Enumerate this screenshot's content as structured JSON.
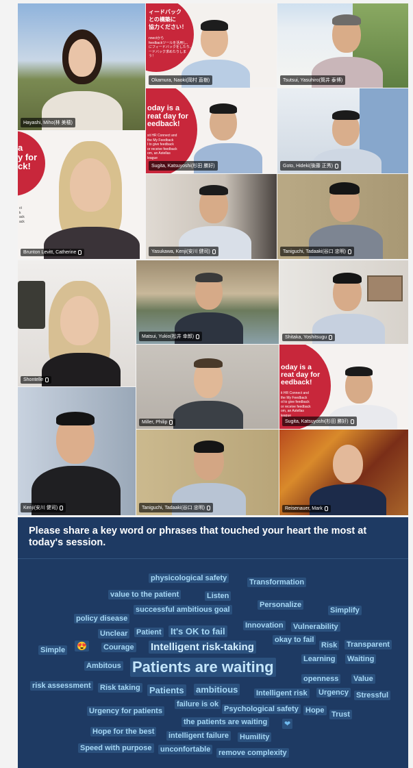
{
  "panel1": {
    "tiles": [
      {
        "name": "Hayashi, Miho(林 美穂)"
      },
      {
        "name": "Okamura, Naoki(岡村 直樹)"
      },
      {
        "name": "Tsutsui, Yasuhiro(筒井 泰博)"
      },
      {
        "name": "Brunton Levitt, Catherine"
      },
      {
        "name": "Sugita, Katsuyoshi(杉田 勝好)"
      },
      {
        "name": "Goto, Hideki(後藤 正秀)"
      },
      {
        "name": "Yasukawa, Kenji(安川 健司)"
      },
      {
        "name": "Taniguchi, Tadaaki(谷口 忠明)"
      }
    ],
    "poster_top": {
      "line1": "ィードバック",
      "line2": "との構築に",
      "line3": "協力ください！",
      "small": "nnectから\nfeedbackツールを活用し、\nにフィードバックをしたり、\nードバック求めたりしま\nう！"
    },
    "poster_mid": {
      "title": "oday is a\nreat day for\needback!",
      "small": "sit HR Connect and\nthe My Feedback\nl to give feedback\nor receive feedback\nom, an Astellas\nleague"
    },
    "poster_left": {
      "title": "a\ny for\nck!",
      "small": "ct\nk\nack\nack"
    }
  },
  "panel2": {
    "tiles": [
      {
        "name": "Shontelle"
      },
      {
        "name": "Matsui, Yukio(松井 幸郎)"
      },
      {
        "name": "Shitaka, Yoshitsugu"
      },
      {
        "name": "Miller, Philip"
      },
      {
        "name": "Sugita, Katsuyoshi(杉田 勝好)"
      },
      {
        "name": "Kenji(安川 健司)"
      },
      {
        "name": "Taniguchi, Tadaaki(谷口 忠明)"
      },
      {
        "name": "Reisenauer, Mark"
      }
    ],
    "poster": {
      "title": "oday is a\nreat day for\needback!",
      "small": "it HR Connect and\nthe My Feedback\nol to give feedback\nor receive feedback\nom, an Astellas\nleague"
    }
  },
  "cloud": {
    "prompt": "Please share a key word or phrases that touched your heart the most at today's session.",
    "emoji": "😍",
    "heart": "❤",
    "words": [
      "physicological safety",
      "Transformation",
      "value to the patient",
      "Listen",
      "Personalize",
      "successful ambitious goal",
      "Simplify",
      "policy disease",
      "Innovation",
      "Vulnerability",
      "Unclear",
      "Patient",
      "It's OK to fail",
      "okay to fail",
      "Simple",
      "Courage",
      "Intelligent risk-taking",
      "Risk",
      "Transparent",
      "Learning",
      "Waiting",
      "Ambitous",
      "Patients are waiting",
      "openness",
      "Value",
      "risk assessment",
      "Risk taking",
      "Patients",
      "ambitious",
      "Intelligent risk",
      "Urgency",
      "Stressful",
      "failure is ok",
      "Urgency for patients",
      "Psychological safety",
      "Hope",
      "Trust",
      "the patients are waiting",
      "Hope for the best",
      "intelligent failure",
      "Humility",
      "Speed with purpose",
      "unconfortable",
      "remove complexity"
    ]
  },
  "colors": {
    "accent": "#6b63c4",
    "cloud_bg": "#1e3a63",
    "word": "#a7d8f5",
    "poster_red": "#c8273b"
  }
}
